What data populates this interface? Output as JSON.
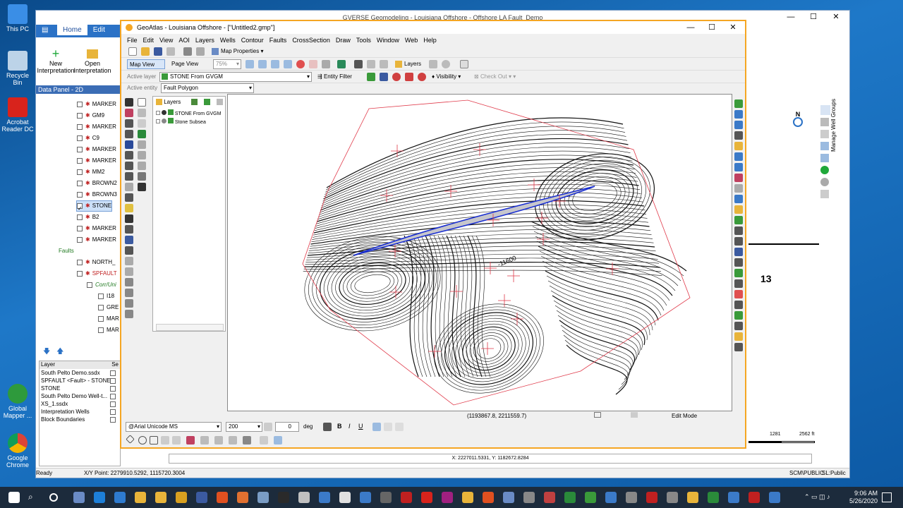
{
  "desktop": {
    "icons": [
      {
        "label": "This PC"
      },
      {
        "label": "Recycle Bin"
      },
      {
        "label": "Acrobat Reader DC"
      },
      {
        "label": "Global Mapper ..."
      },
      {
        "label": "Google Chrome"
      }
    ]
  },
  "back_window": {
    "title": "GVERSE Geomodeling - Louisiana Offshore - Offshore LA Fault_Demo",
    "tabs": [
      "Home",
      "Edit"
    ],
    "ribbon": {
      "new_interpretation": "New Interpretation",
      "open_interpretation": "Open Interpretation"
    },
    "data_panel_title": "Data Panel - 2D",
    "tree": [
      {
        "label": "MARKER",
        "checked": false
      },
      {
        "label": "GM9",
        "checked": false
      },
      {
        "label": "MARKER",
        "checked": false
      },
      {
        "label": "C9",
        "checked": false
      },
      {
        "label": "MARKER",
        "checked": false
      },
      {
        "label": "MARKER",
        "checked": false
      },
      {
        "label": "MM2",
        "checked": false
      },
      {
        "label": "BROWN2",
        "checked": false
      },
      {
        "label": "BROWN3",
        "checked": false
      },
      {
        "label": "STONE",
        "checked": true
      },
      {
        "label": "B2",
        "checked": false
      },
      {
        "label": "MARKER",
        "checked": false
      },
      {
        "label": "MARKER",
        "checked": false
      }
    ],
    "faults_label": "Faults",
    "fault_items": [
      "NORTH_",
      "SPFAULT",
      "Corr/Uni"
    ],
    "sub_items": [
      "I18",
      "GRE",
      "MAR",
      "MAR"
    ],
    "layer_list_header": "Layer",
    "layer_list_col2": "Se",
    "layer_list": [
      "South Pelto Demo.ssdx",
      "SPFAULT <Fault> - STONE",
      "STONE",
      "South Pelto Demo Well-t...",
      "XS_1.ssdx",
      "Interpretation Wells",
      "Block Boundaries"
    ],
    "map_label_13": "13",
    "north_label": "N",
    "scale_labels": [
      "1281",
      "2562 ft"
    ],
    "right_vertical_label": "Manage Well Groups",
    "bottom_xy": "X: 2227011.5331, Y: 1182672.8284",
    "status_ready": "Ready",
    "status_xy": "X/Y Point: 2279910.5292, 1115720.3004",
    "status_right": "SCM\\PUBLIC",
    "status_right2": "SL:Public"
  },
  "main_window": {
    "title": "GeoAtlas - Louisiana Offshore - [\"Untitled2.gmp\"]",
    "menu": [
      "File",
      "Edit",
      "View",
      "AOI",
      "Layers",
      "Wells",
      "Contour",
      "Faults",
      "CrossSection",
      "Draw",
      "Tools",
      "Window",
      "Web",
      "Help"
    ],
    "map_properties": "Map Properties",
    "map_view": "Map View",
    "page_view": "Page View",
    "zoom": "75%",
    "layers_btn": "Layers",
    "active_layer_label": "Active layer",
    "active_layer_value": "STONE From GVGM",
    "entity_filter": "Entity Filter",
    "visibility": "Visibility",
    "check_out": "Check Out",
    "active_entity_label": "Active entity",
    "active_entity_value": "Fault Polygon",
    "layers_panel": {
      "title": "Layers",
      "items": [
        "STONE From GVGM",
        "Stone Subsea"
      ]
    },
    "contour_label": "-11600",
    "status_coords": "(1193867.8, 2211559.7)",
    "edit_mode": "Edit Mode",
    "font_name": "@Arial Unicode MS",
    "font_size": "200",
    "angle_value": "0",
    "angle_unit": "deg"
  },
  "taskbar": {
    "time": "9:06 AM",
    "date": "5/26/2020"
  },
  "colors": {
    "accent_orange": "#f5a623",
    "selection_blue": "#2b72c6",
    "fault_blue": "#1a2fd0",
    "boundary_red": "#e03a4a"
  }
}
